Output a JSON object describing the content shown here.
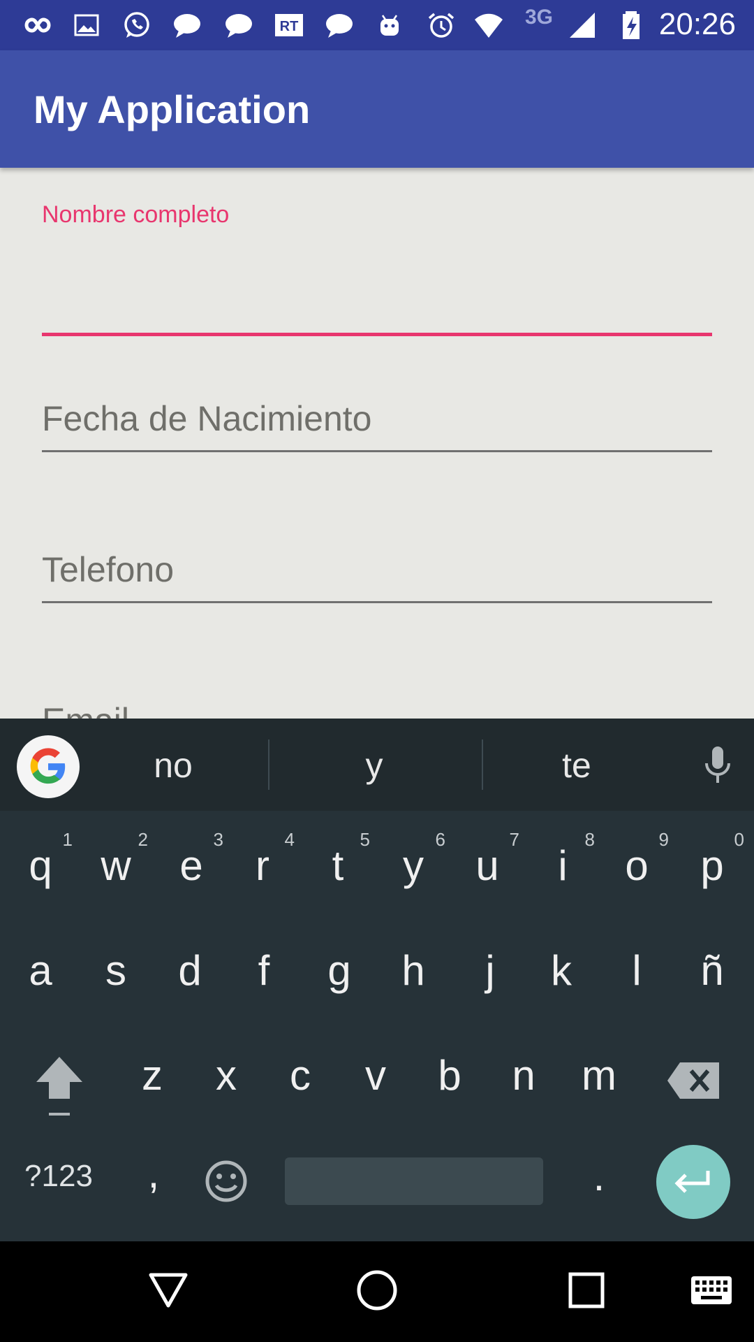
{
  "status_bar": {
    "time": "20:26",
    "network": "3G",
    "icons": [
      "infinity-icon",
      "gallery-icon",
      "whatsapp-icon",
      "chat-bubble-icon",
      "chat-bubble-icon",
      "rt-news-icon",
      "chat-bubble-icon",
      "android-icon",
      "alarm-icon",
      "wifi-icon",
      "signal-icon",
      "battery-charging-icon"
    ]
  },
  "app_bar": {
    "title": "My Application"
  },
  "form": {
    "full_name_label": "Nombre completo",
    "birth_date_placeholder": "Fecha de Nacimiento",
    "phone_placeholder": "Telefono",
    "email_placeholder": "Email"
  },
  "keyboard": {
    "suggestions": [
      "no",
      "y",
      "te"
    ],
    "row1": [
      "q",
      "w",
      "e",
      "r",
      "t",
      "y",
      "u",
      "i",
      "o",
      "p"
    ],
    "row1_hints": [
      "1",
      "2",
      "3",
      "4",
      "5",
      "6",
      "7",
      "8",
      "9",
      "0"
    ],
    "row2": [
      "a",
      "s",
      "d",
      "f",
      "g",
      "h",
      "j",
      "k",
      "l",
      "ñ"
    ],
    "row3": [
      "z",
      "x",
      "c",
      "v",
      "b",
      "n",
      "m"
    ],
    "symbols_key": "?123",
    "comma_key": ",",
    "period_key": ".",
    "accent_color": "#80cbc4"
  },
  "colors": {
    "primary": "#3f51a8",
    "primary_dark": "#2e3b96",
    "accent": "#e8366e"
  }
}
